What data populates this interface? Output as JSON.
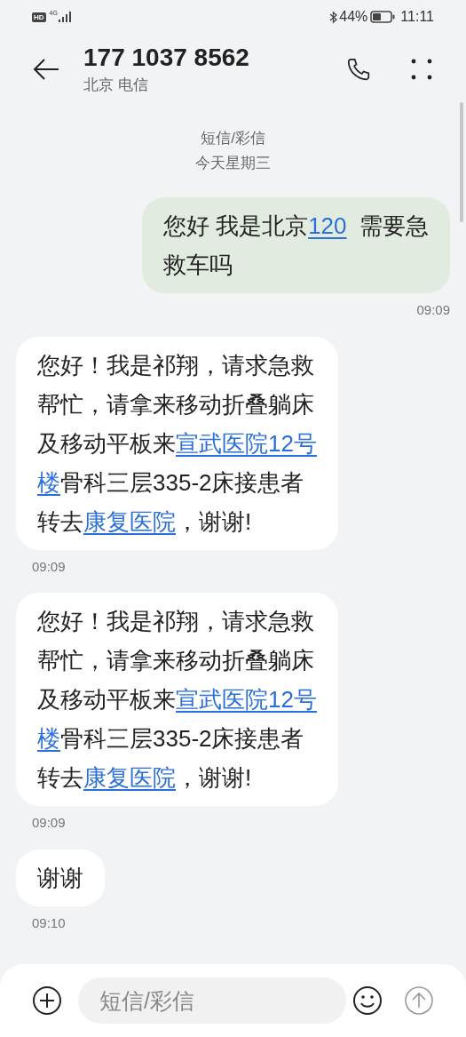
{
  "status_bar": {
    "hd": "HD",
    "network": "4G",
    "battery": "44%",
    "time": "11:11"
  },
  "header": {
    "title": "177 1037 8562",
    "subtitle": "北京 电信"
  },
  "thread_info": {
    "type": "短信/彩信",
    "date": "今天星期三"
  },
  "messages": [
    {
      "kind": "sent",
      "lines": [
        [
          {
            "text": "您好 我是北京",
            "link": false
          },
          {
            "text": "120",
            "link": true
          },
          {
            "text": "  需要急",
            "link": false
          }
        ],
        [
          {
            "text": "救车吗",
            "link": false
          }
        ]
      ],
      "time": "09:09"
    },
    {
      "kind": "received",
      "lines": [
        [
          {
            "text": "您好！我是祁翔，请求急救",
            "link": false
          }
        ],
        [
          {
            "text": "帮忙，请拿来移动折叠躺床",
            "link": false
          }
        ],
        [
          {
            "text": "及移动平板来",
            "link": false
          },
          {
            "text": "宣武医院12号",
            "link": true
          }
        ],
        [
          {
            "text": "楼",
            "link": true
          },
          {
            "text": "骨科三层335-2床接患者",
            "link": false
          }
        ],
        [
          {
            "text": "转去",
            "link": false
          },
          {
            "text": "康复医院",
            "link": true
          },
          {
            "text": "，谢谢!",
            "link": false
          }
        ]
      ],
      "time": "09:09"
    },
    {
      "kind": "received",
      "lines": [
        [
          {
            "text": "您好！我是祁翔，请求急救",
            "link": false
          }
        ],
        [
          {
            "text": "帮忙，请拿来移动折叠躺床",
            "link": false
          }
        ],
        [
          {
            "text": "及移动平板来",
            "link": false
          },
          {
            "text": "宣武医院12号",
            "link": true
          }
        ],
        [
          {
            "text": "楼",
            "link": true
          },
          {
            "text": "骨科三层335-2床接患者",
            "link": false
          }
        ],
        [
          {
            "text": "转去",
            "link": false
          },
          {
            "text": "康复医院",
            "link": true
          },
          {
            "text": "，谢谢!",
            "link": false
          }
        ]
      ],
      "time": "09:09"
    },
    {
      "kind": "received",
      "lines": [
        [
          {
            "text": "谢谢",
            "link": false
          }
        ]
      ],
      "time": "09:10"
    }
  ],
  "composer": {
    "placeholder": "短信/彩信"
  }
}
